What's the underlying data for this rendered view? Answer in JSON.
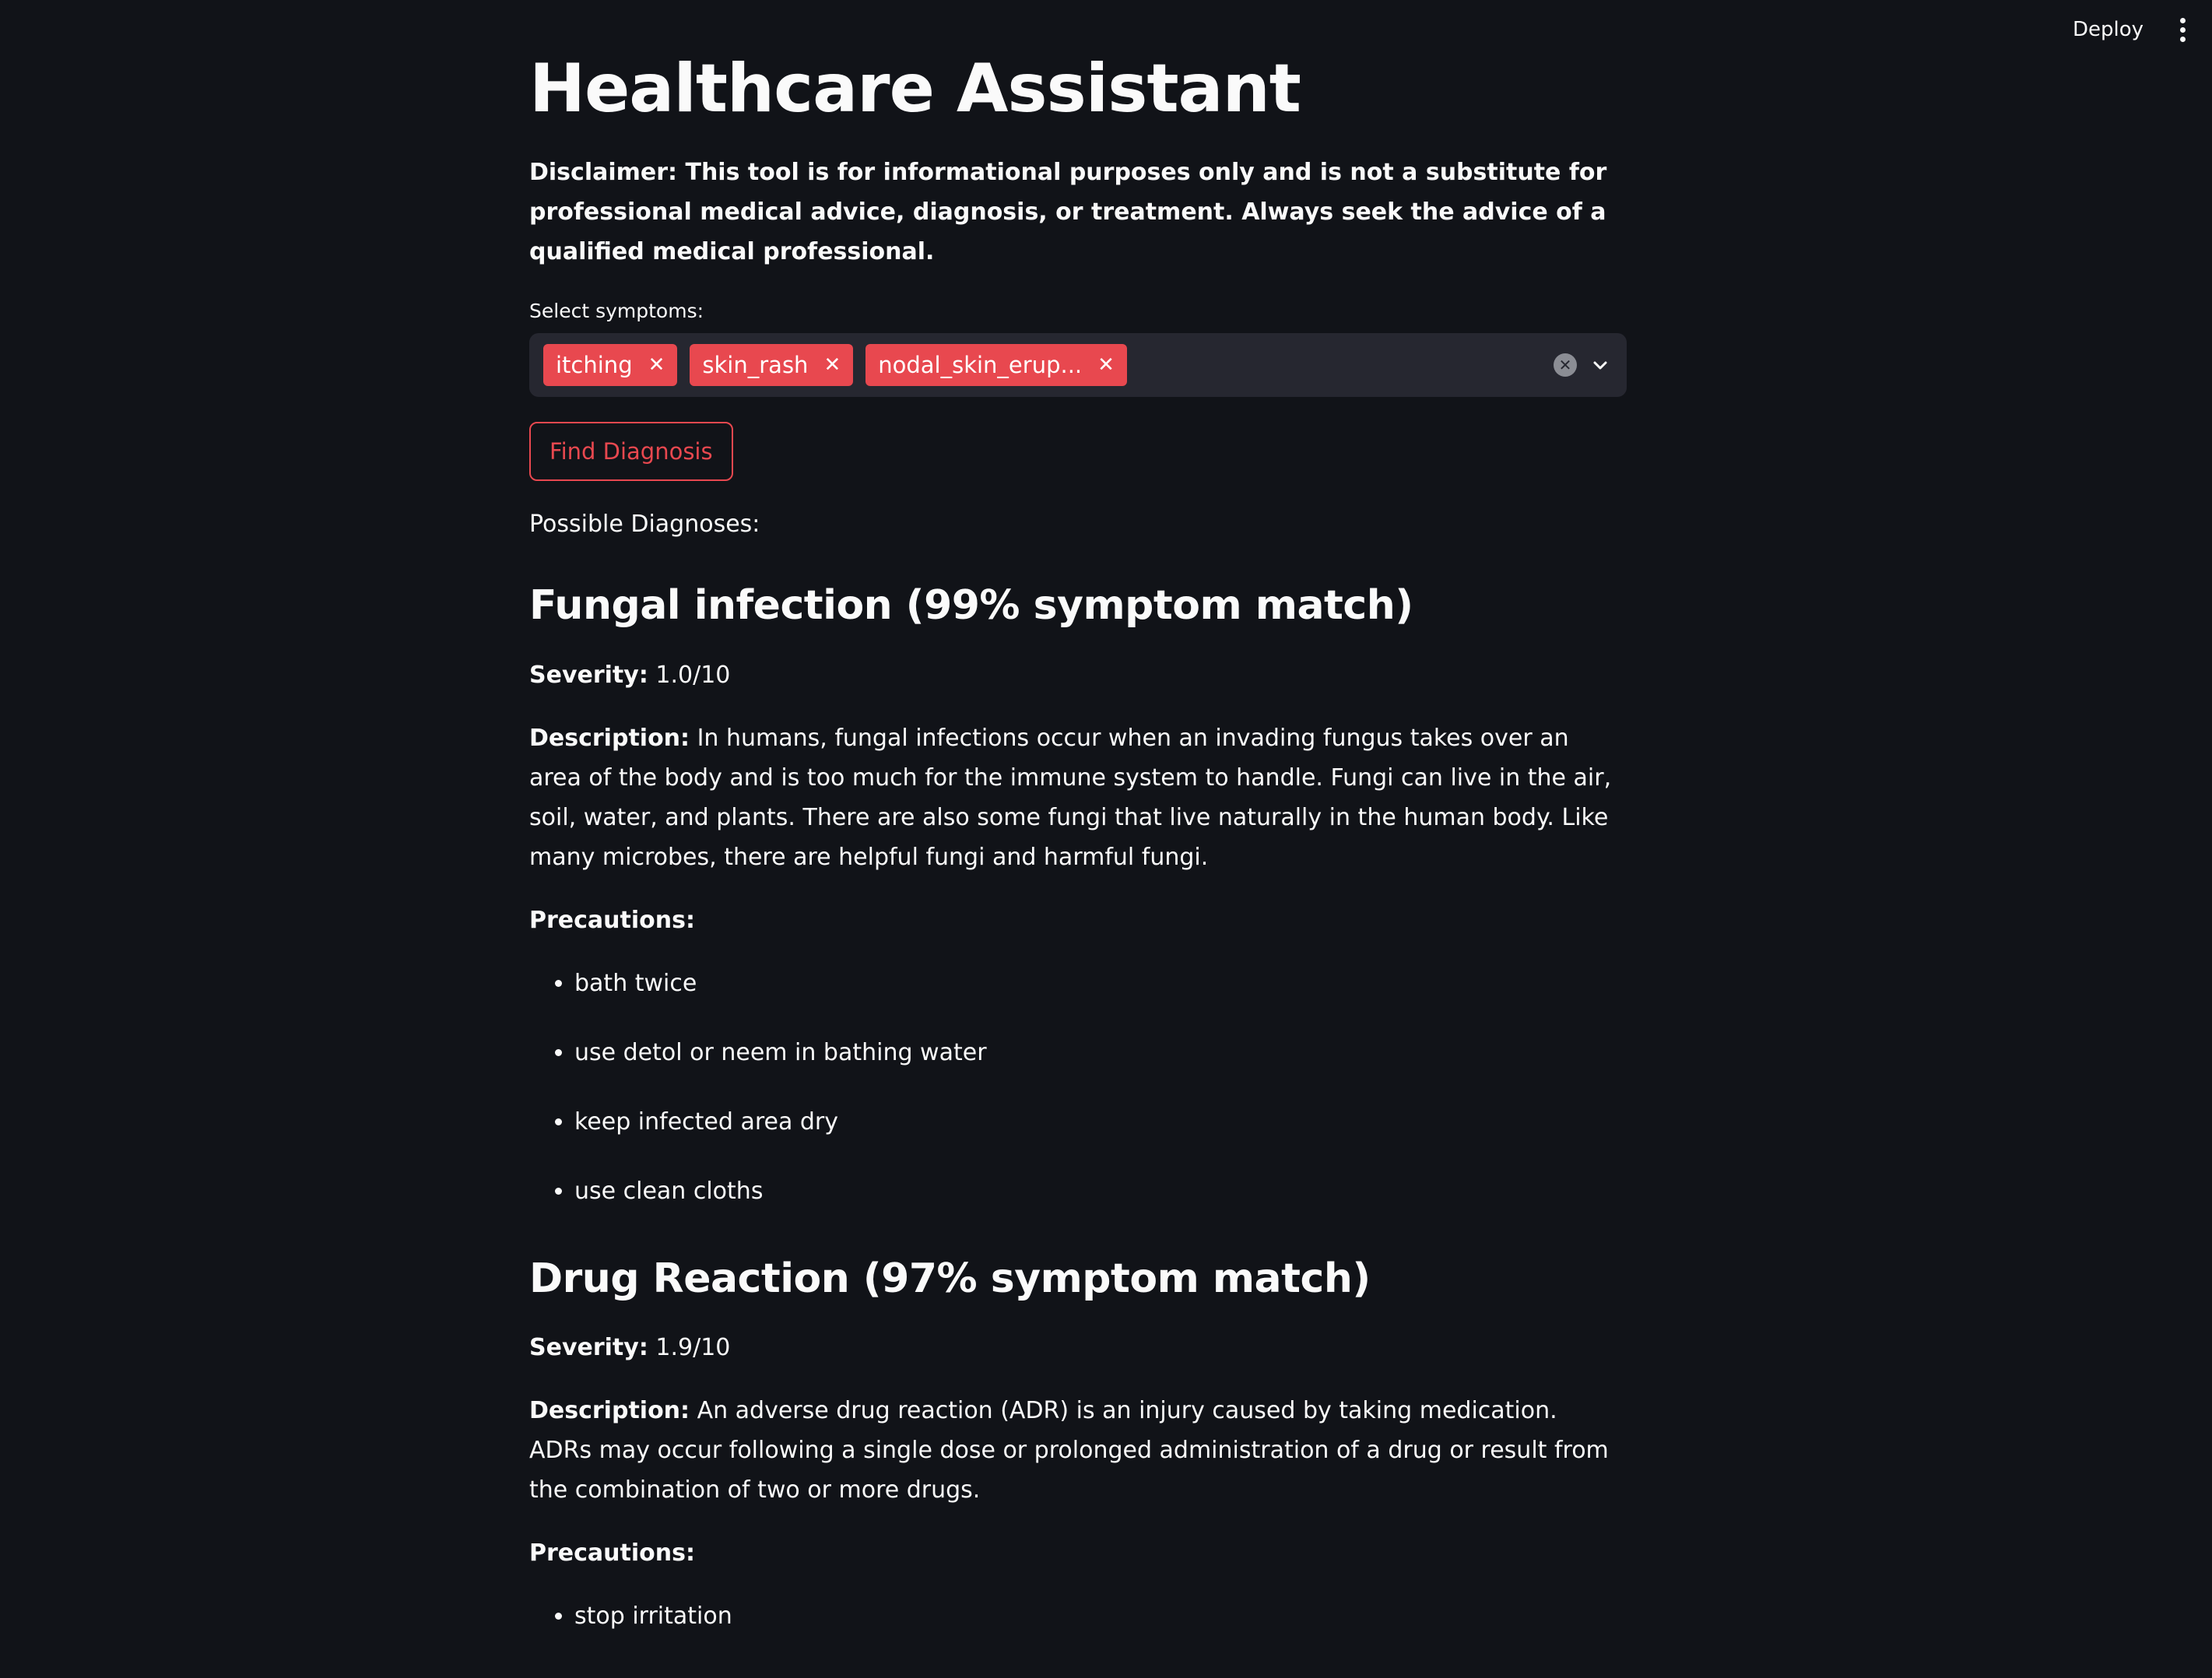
{
  "header": {
    "deploy_label": "Deploy",
    "menu_icon": "kebab-vertical-icon"
  },
  "main": {
    "title": "Healthcare Assistant",
    "disclaimer": "Disclaimer: This tool is for informational purposes only and is not a substitute for professional medical advice, diagnosis, or treatment. Always seek the advice of a qualified medical professional.",
    "symptoms_label": "Select symptoms:",
    "selected_symptoms": [
      "itching",
      "skin_rash",
      "nodal_skin_erup..."
    ],
    "find_button_label": "Find Diagnosis",
    "results_label": "Possible Diagnoses:"
  },
  "diagnoses": [
    {
      "title": "Fungal infection (99% symptom match)",
      "severity_label": "Severity:",
      "severity_value": "1.0/10",
      "description_label": "Description:",
      "description": "In humans, fungal infections occur when an invading fungus takes over an area of the body and is too much for the immune system to handle. Fungi can live in the air, soil, water, and plants. There are also some fungi that live naturally in the human body. Like many microbes, there are helpful fungi and harmful fungi.",
      "precautions_label": "Precautions:",
      "precautions": [
        "bath twice",
        "use detol or neem in bathing water",
        "keep infected area dry",
        "use clean cloths"
      ]
    },
    {
      "title": "Drug Reaction (97% symptom match)",
      "severity_label": "Severity:",
      "severity_value": "1.9/10",
      "description_label": "Description:",
      "description": "An adverse drug reaction (ADR) is an injury caused by taking medication. ADRs may occur following a single dose or prolonged administration of a drug or result from the combination of two or more drugs.",
      "precautions_label": "Precautions:",
      "precautions": [
        "stop irritation"
      ]
    }
  ],
  "colors": {
    "background": "#111318",
    "accent": "#e8484f",
    "input_bg": "#262730"
  }
}
